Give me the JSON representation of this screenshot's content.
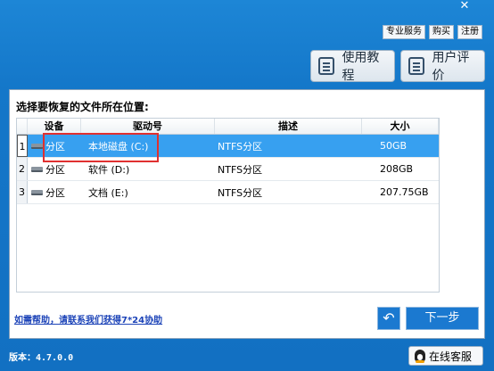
{
  "window": {
    "close_label": "✕"
  },
  "top_links": [
    "专业服务",
    "购买",
    "注册"
  ],
  "buttons": {
    "tutorial": "使用教程",
    "review": "用户评价",
    "back_glyph": "↶",
    "next": "下一步",
    "customer_service": "在线客服"
  },
  "panel": {
    "title": "选择要恢复的文件所在位置:"
  },
  "table": {
    "headers": {
      "device": "设备",
      "drive": "驱动号",
      "desc": "描述",
      "size": "大小"
    },
    "rows": [
      {
        "num": "1",
        "device": "分区",
        "drive": "本地磁盘 (C:)",
        "desc": "NTFS分区",
        "size": "50GB"
      },
      {
        "num": "2",
        "device": "分区",
        "drive": "软件 (D:)",
        "desc": "NTFS分区",
        "size": "208GB"
      },
      {
        "num": "3",
        "device": "分区",
        "drive": "文档 (E:)",
        "desc": "NTFS分区",
        "size": "207.75GB"
      }
    ]
  },
  "help": "如需帮助，请联系我们获得7*24协助",
  "version": "版本：4.7.0.0",
  "colors": {
    "accent": "#1477c9",
    "selection": "#37a0f0",
    "highlight_box": "#e03030"
  }
}
